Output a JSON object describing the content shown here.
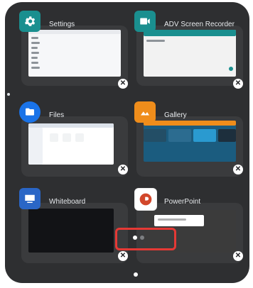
{
  "apps": [
    {
      "key": "settings",
      "title": "Settings",
      "icon": "settings-icon",
      "accent": "#1a8f8f"
    },
    {
      "key": "adv",
      "title": "ADV Screen Recorder",
      "icon": "video-camera-icon",
      "accent": "#1a8f8f"
    },
    {
      "key": "files",
      "title": "Files",
      "icon": "folder-icon",
      "accent": "#1a73e8"
    },
    {
      "key": "gallery",
      "title": "Gallery",
      "icon": "image-icon",
      "accent": "#ef8d1b"
    },
    {
      "key": "whiteboard",
      "title": "Whiteboard",
      "icon": "whiteboard-icon",
      "accent": "#2a66c6"
    },
    {
      "key": "powerpoint",
      "title": "PowerPoint",
      "icon": "powerpoint-icon",
      "accent": "#d2472b"
    }
  ],
  "close_glyph": "✕",
  "pager": {
    "pages": 2,
    "active": 1,
    "highlight": "#e53935"
  }
}
